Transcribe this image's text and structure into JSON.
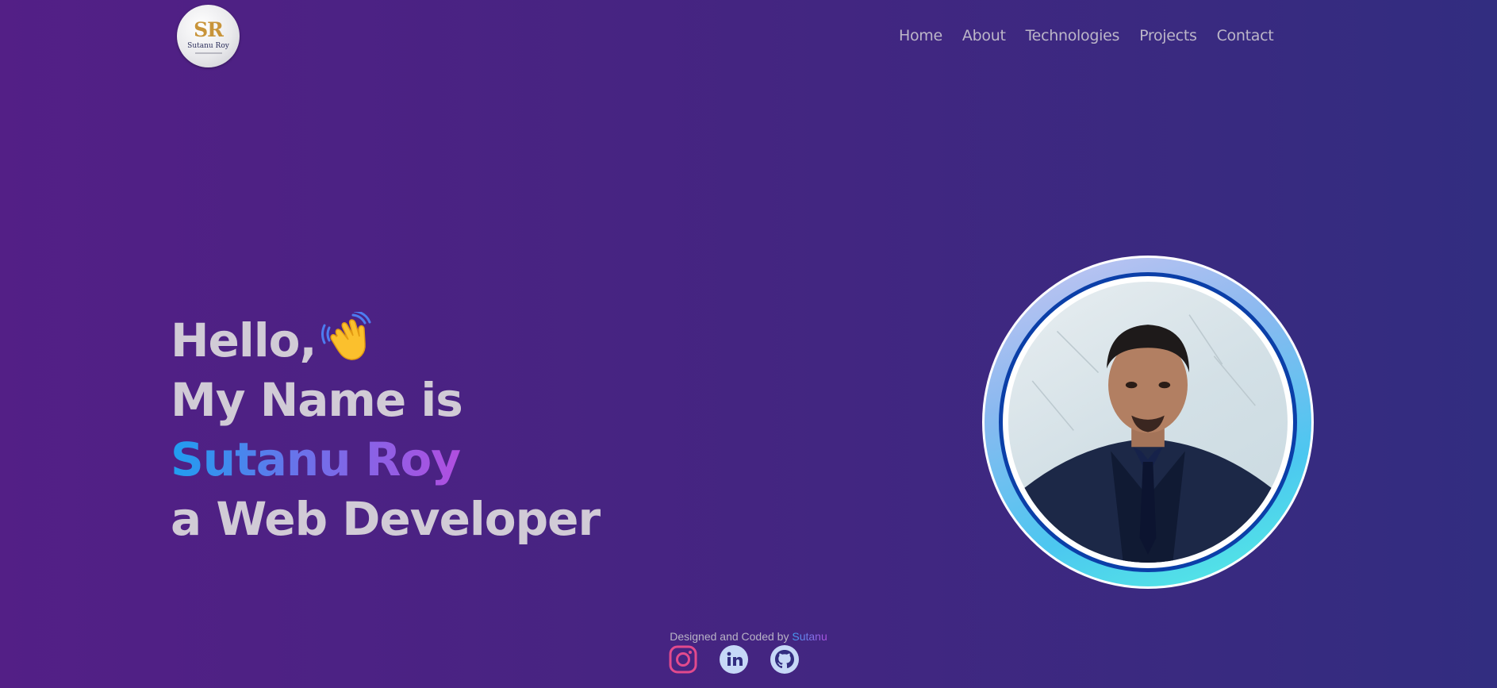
{
  "header": {
    "logo": {
      "mark": "SR",
      "text": "Sutanu Roy"
    },
    "nav": [
      {
        "label": "Home"
      },
      {
        "label": "About"
      },
      {
        "label": "Technologies"
      },
      {
        "label": "Projects"
      },
      {
        "label": "Contact"
      }
    ]
  },
  "hero": {
    "greeting": "Hello,",
    "intro": "My Name is",
    "name": "Sutanu Roy",
    "role": "a Web Developer",
    "wave_icon": "waving-hand-icon"
  },
  "footer": {
    "credit": "Designed and Coded by",
    "author": "Sutanu",
    "socials": [
      {
        "icon": "instagram-icon"
      },
      {
        "icon": "linkedin-icon"
      },
      {
        "icon": "github-icon"
      }
    ]
  },
  "colors": {
    "bg_left": "#531f86",
    "bg_right": "#322d80",
    "text": "#d1cbd6",
    "name_gradient_start": "#1f9ef0",
    "name_gradient_end": "#b14ee0",
    "ring_gradient_start": "#c8c6f2",
    "ring_gradient_end": "#55f0e2",
    "instagram": "#e24a8d",
    "linkedin": "#c6d8f7"
  }
}
